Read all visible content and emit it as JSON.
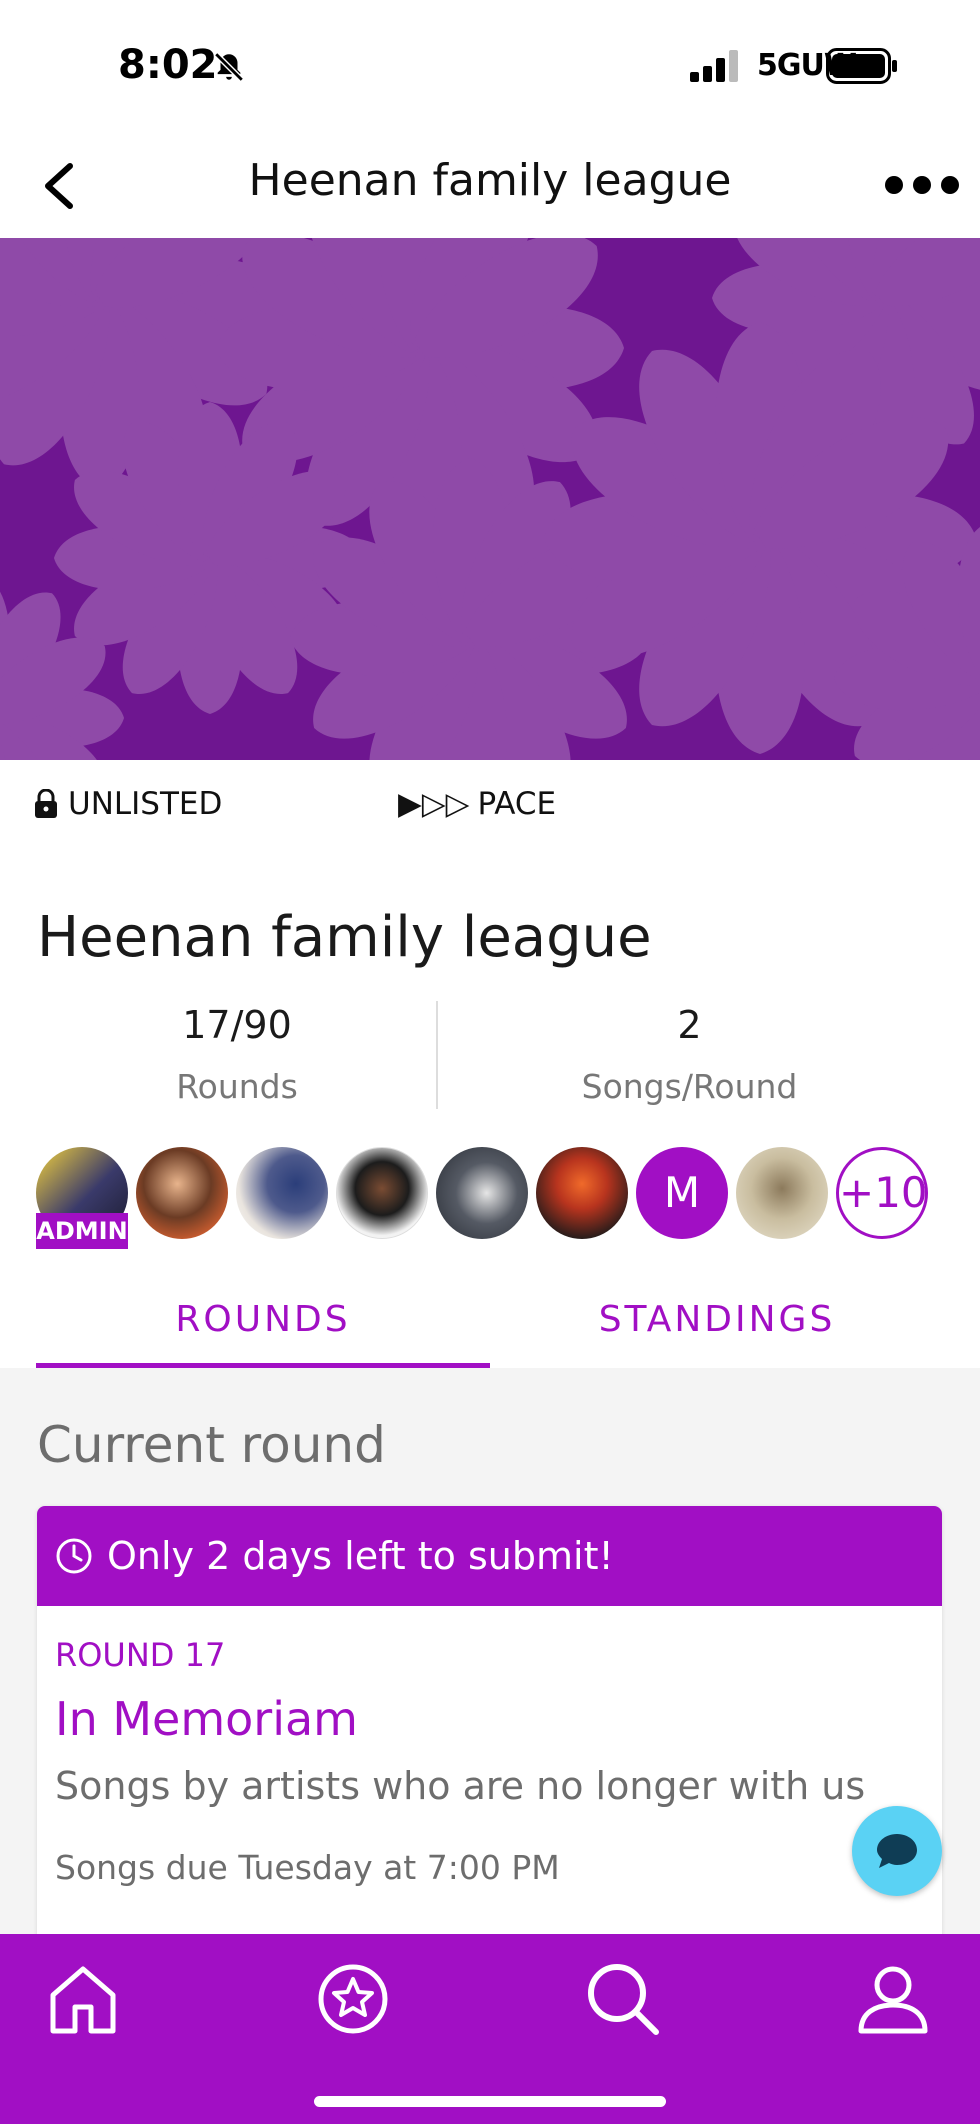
{
  "status_bar": {
    "time": "8:02",
    "network": "5GUW",
    "icons": [
      "bell-slash-icon",
      "signal-bars-icon",
      "battery-icon"
    ]
  },
  "nav": {
    "title": "Heenan family league",
    "icons": [
      "chevron-left-icon",
      "more-dots-icon"
    ]
  },
  "banner": {
    "background_color": "#6e1690",
    "pattern_color": "#8f4aa8"
  },
  "meta": {
    "visibility": "UNLISTED",
    "pace_label": "PACE",
    "pace_arrows": "▶▷▷",
    "icons": [
      "lock-icon"
    ]
  },
  "league": {
    "name": "Heenan family league",
    "rounds_value": "17/90",
    "rounds_label": "Rounds",
    "songs_value": "2",
    "songs_label": "Songs/Round"
  },
  "members": {
    "admin_badge": "ADMIN",
    "letter_avatar": "M",
    "more_count": "+10"
  },
  "tabs": {
    "rounds": "ROUNDS",
    "standings": "STANDINGS",
    "active": "rounds"
  },
  "current_round": {
    "section_title": "Current round",
    "alert": "Only 2 days left to submit!",
    "round_number": "ROUND 17",
    "round_name": "In Memoriam",
    "description": "Songs by artists who are no longer with us",
    "due": "Songs due Tuesday at 7:00 PM"
  },
  "bottom_nav": {
    "items": [
      "home-icon",
      "star-badge-icon",
      "search-icon",
      "profile-icon"
    ]
  },
  "colors": {
    "accent": "#a10fc4",
    "chat_fab": "#5ad2f4",
    "muted_text": "#6d6d6d"
  }
}
